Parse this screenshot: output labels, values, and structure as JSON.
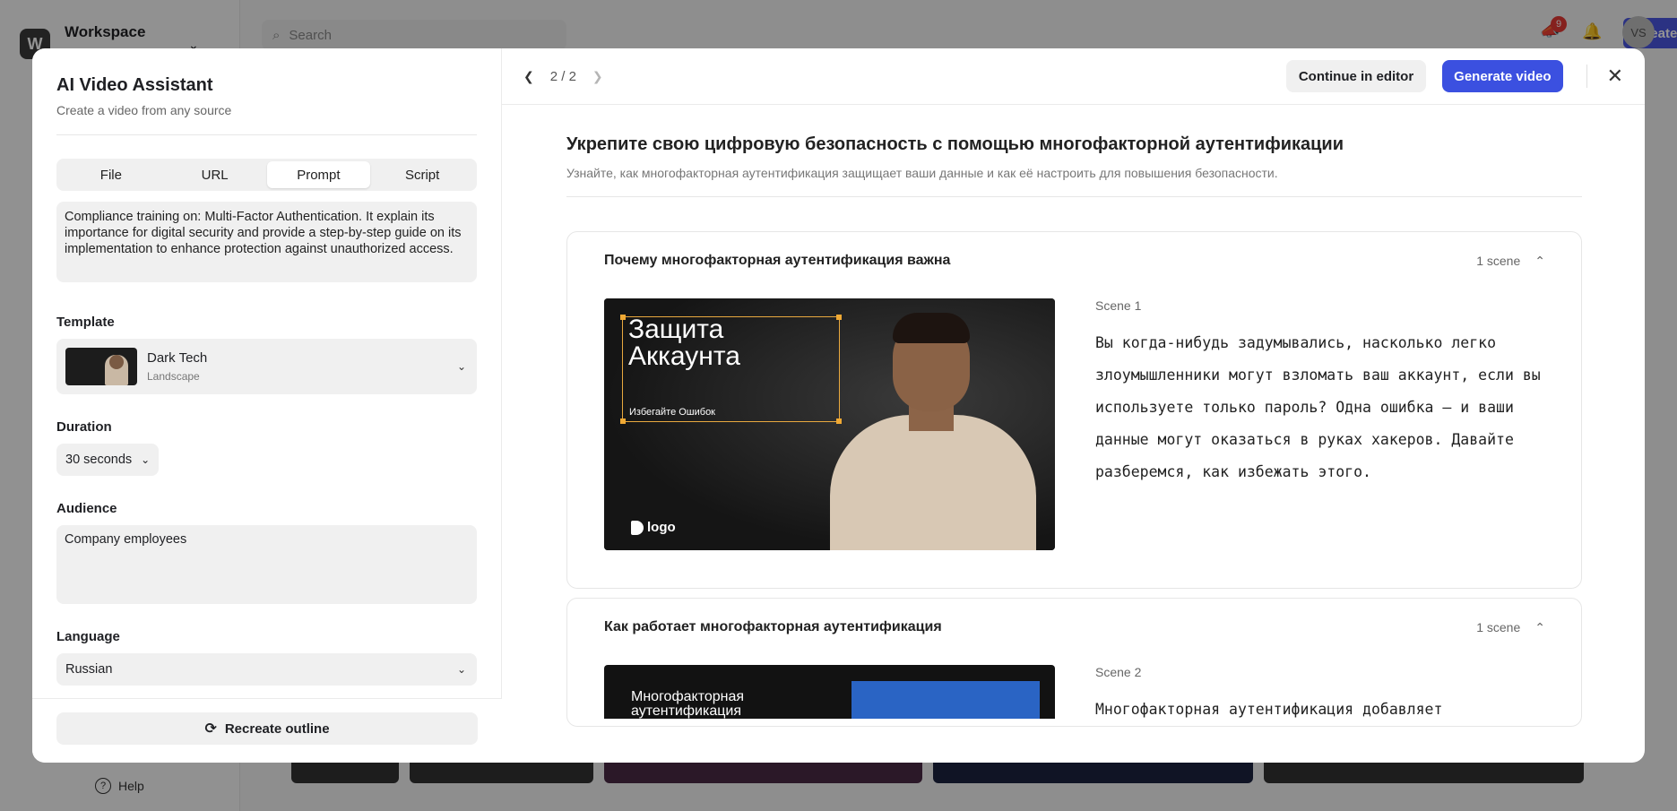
{
  "app": {
    "workspace_initial": "W",
    "workspace_name": "Workspace",
    "search_placeholder": "Search",
    "create_label": "Create",
    "notification_count": "9",
    "user_initials": "VS",
    "help_label": "Help"
  },
  "modal": {
    "title": "AI Video Assistant",
    "subtitle": "Create a video from any source",
    "tabs": [
      {
        "label": "File",
        "active": false
      },
      {
        "label": "URL",
        "active": false
      },
      {
        "label": "Prompt",
        "active": true
      },
      {
        "label": "Script",
        "active": false
      }
    ],
    "prompt_text": "Compliance training on: Multi-Factor Authentication. It explain its importance for digital security and provide a step-by-step guide on its implementation to enhance protection against unauthorized access.",
    "template": {
      "label": "Template",
      "name": "Dark Tech",
      "orientation": "Landscape"
    },
    "duration": {
      "label": "Duration",
      "value": "30 seconds"
    },
    "audience": {
      "label": "Audience",
      "value": "Company employees"
    },
    "language": {
      "label": "Language",
      "value": "Russian"
    },
    "recreate_label": "Recreate outline"
  },
  "preview": {
    "pager": "2 / 2",
    "continue_label": "Continue in editor",
    "generate_label": "Generate video",
    "title": "Укрепите свою цифровую безопасность с помощью многофакторной аутентификации",
    "subtitle": "Узнайте, как многофакторная аутентификация защищает ваши данные и как её настроить для повышения безопасности.",
    "sections": [
      {
        "title": "Почему многофакторная аутентификация важна",
        "scene_count": "1 scene",
        "scene_label": "Scene 1",
        "thumb_heading_line1": "Защита",
        "thumb_heading_line2": "Аккаунта",
        "thumb_subheading": "Избегайте Ошибок",
        "thumb_logo": "logo",
        "script": "Вы когда-нибудь задумывались, насколько легко злоумышленники могут взломать ваш аккаунт, если вы используете только пароль? Одна ошибка — и ваши данные могут оказаться в руках хакеров. Давайте разберемся, как избежать этого."
      },
      {
        "title": "Как работает многофакторная аутентификация",
        "scene_count": "1 scene",
        "scene_label": "Scene 2",
        "thumb_heading_line1": "Многофакторная",
        "thumb_heading_line2": "аутентификация",
        "script": "Многофакторная аутентификация добавляет"
      }
    ]
  },
  "colors": {
    "primary": "#3b50e0",
    "selection": "#f0a934"
  }
}
